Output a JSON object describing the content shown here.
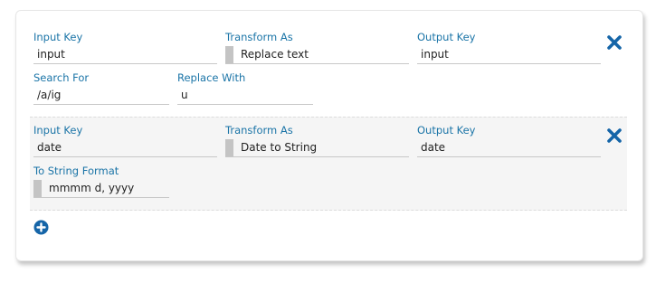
{
  "colors": {
    "label": "#1a74a7",
    "icon": "#1565a8"
  },
  "rows": [
    {
      "fields": [
        {
          "label": "Input Key",
          "value": "input"
        },
        {
          "label": "Transform As",
          "value": "Replace text"
        },
        {
          "label": "Output Key",
          "value": "input"
        },
        {
          "label": "Search For",
          "value": "/a/ig"
        },
        {
          "label": "Replace With",
          "value": "u"
        }
      ],
      "remove_icon": "close-icon"
    },
    {
      "fields": [
        {
          "label": "Input Key",
          "value": "date"
        },
        {
          "label": "Transform As",
          "value": "Date to String"
        },
        {
          "label": "Output Key",
          "value": "date"
        },
        {
          "label": "To String Format",
          "value": "mmmm d, yyyy"
        }
      ],
      "remove_icon": "close-icon"
    }
  ],
  "add_icon": "plus-circle-icon"
}
